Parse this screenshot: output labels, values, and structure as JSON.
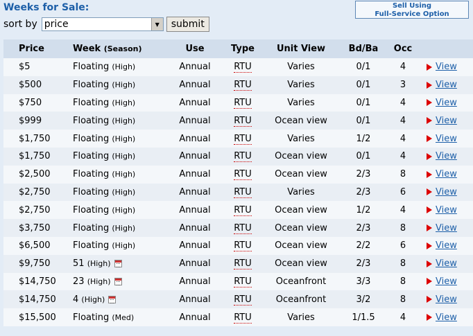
{
  "header": {
    "title": "Weeks for Sale:",
    "sell_line1": "Sell Using",
    "sell_line2": "Full-Service Option"
  },
  "sort": {
    "label": "sort by",
    "selected": "price",
    "submit_label": "submit"
  },
  "columns": {
    "price": "Price",
    "week": "Week",
    "season": "(Season)",
    "use": "Use",
    "type": "Type",
    "unit_view": "Unit View",
    "bdba": "Bd/Ba",
    "occ": "Occ"
  },
  "rows": [
    {
      "price": "$5",
      "week": "Floating",
      "season": "(High)",
      "use": "Annual",
      "type": "RTU",
      "view": "Varies",
      "bdba": "0/1",
      "occ": "4",
      "link": "View",
      "cal": false
    },
    {
      "price": "$500",
      "week": "Floating",
      "season": "(High)",
      "use": "Annual",
      "type": "RTU",
      "view": "Varies",
      "bdba": "0/1",
      "occ": "3",
      "link": "View",
      "cal": false
    },
    {
      "price": "$750",
      "week": "Floating",
      "season": "(High)",
      "use": "Annual",
      "type": "RTU",
      "view": "Varies",
      "bdba": "0/1",
      "occ": "4",
      "link": "View",
      "cal": false
    },
    {
      "price": "$999",
      "week": "Floating",
      "season": "(High)",
      "use": "Annual",
      "type": "RTU",
      "view": "Ocean view",
      "bdba": "0/1",
      "occ": "4",
      "link": "View",
      "cal": false
    },
    {
      "price": "$1,750",
      "week": "Floating",
      "season": "(High)",
      "use": "Annual",
      "type": "RTU",
      "view": "Varies",
      "bdba": "1/2",
      "occ": "4",
      "link": "View",
      "cal": false
    },
    {
      "price": "$1,750",
      "week": "Floating",
      "season": "(High)",
      "use": "Annual",
      "type": "RTU",
      "view": "Ocean view",
      "bdba": "0/1",
      "occ": "4",
      "link": "View",
      "cal": false
    },
    {
      "price": "$2,500",
      "week": "Floating",
      "season": "(High)",
      "use": "Annual",
      "type": "RTU",
      "view": "Ocean view",
      "bdba": "2/3",
      "occ": "8",
      "link": "View",
      "cal": false
    },
    {
      "price": "$2,750",
      "week": "Floating",
      "season": "(High)",
      "use": "Annual",
      "type": "RTU",
      "view": "Varies",
      "bdba": "2/3",
      "occ": "6",
      "link": "View",
      "cal": false
    },
    {
      "price": "$2,750",
      "week": "Floating",
      "season": "(High)",
      "use": "Annual",
      "type": "RTU",
      "view": "Ocean view",
      "bdba": "1/2",
      "occ": "4",
      "link": "View",
      "cal": false
    },
    {
      "price": "$3,750",
      "week": "Floating",
      "season": "(High)",
      "use": "Annual",
      "type": "RTU",
      "view": "Ocean view",
      "bdba": "2/3",
      "occ": "8",
      "link": "View",
      "cal": false
    },
    {
      "price": "$6,500",
      "week": "Floating",
      "season": "(High)",
      "use": "Annual",
      "type": "RTU",
      "view": "Ocean view",
      "bdba": "2/2",
      "occ": "6",
      "link": "View",
      "cal": false
    },
    {
      "price": "$9,750",
      "week": "51",
      "season": "(High)",
      "use": "Annual",
      "type": "RTU",
      "view": "Ocean view",
      "bdba": "2/3",
      "occ": "8",
      "link": "View",
      "cal": true
    },
    {
      "price": "$14,750",
      "week": "23",
      "season": "(High)",
      "use": "Annual",
      "type": "RTU",
      "view": "Oceanfront",
      "bdba": "3/3",
      "occ": "8",
      "link": "View",
      "cal": true
    },
    {
      "price": "$14,750",
      "week": "4",
      "season": "(High)",
      "use": "Annual",
      "type": "RTU",
      "view": "Oceanfront",
      "bdba": "3/2",
      "occ": "8",
      "link": "View",
      "cal": true
    },
    {
      "price": "$15,500",
      "week": "Floating",
      "season": "(Med)",
      "use": "Annual",
      "type": "RTU",
      "view": "Varies",
      "bdba": "1/1.5",
      "occ": "4",
      "link": "View",
      "cal": false
    }
  ]
}
